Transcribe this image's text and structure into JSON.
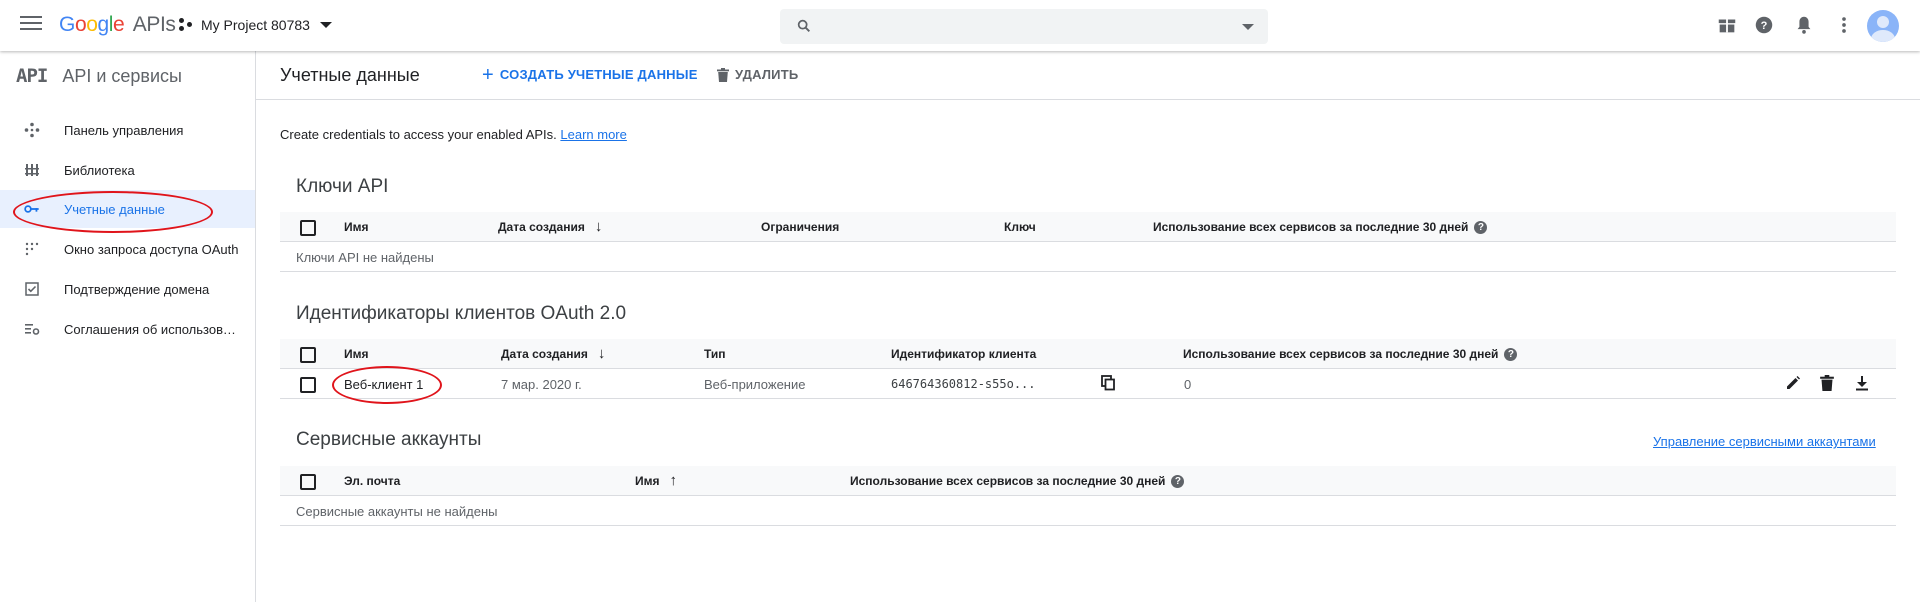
{
  "topbar": {
    "logo_google": "Google",
    "logo_apis": "APIs",
    "project_name": "My Project 80783",
    "search_placeholder": ""
  },
  "icons": {
    "menu": "menu-icon",
    "project": "project-dots-icon",
    "search": "search-icon",
    "gift": "gift-icon",
    "help": "help-icon",
    "notifications": "bell-icon",
    "more": "more-vert-icon",
    "avatar": "account-avatar"
  },
  "sidebar": {
    "api_logo": "API",
    "title": "API и сервисы",
    "items": [
      {
        "label": "Панель управления",
        "icon": "dashboard-icon",
        "active": false
      },
      {
        "label": "Библиотека",
        "icon": "library-icon",
        "active": false
      },
      {
        "label": "Учетные данные",
        "icon": "key-icon",
        "active": true
      },
      {
        "label": "Окно запроса доступа OAuth",
        "icon": "consent-screen-icon",
        "active": false
      },
      {
        "label": "Подтверждение домена",
        "icon": "checkbox-icon",
        "active": false
      },
      {
        "label": "Соглашения об использовании",
        "icon": "settings-list-icon",
        "active": false
      }
    ]
  },
  "page": {
    "title": "Учетные данные",
    "create_label": "СОЗДАТЬ УЧЕТНЫЕ ДАННЫЕ",
    "delete_label": "УДАЛИТЬ",
    "intro_text": "Create credentials to access your enabled APIs.",
    "learn_more": "Learn more"
  },
  "api_keys": {
    "title": "Ключи API",
    "columns": [
      "Имя",
      "Дата создания",
      "Ограничения",
      "Ключ",
      "Использование всех сервисов за последние 30 дней"
    ],
    "empty": "Ключи API не найдены"
  },
  "oauth": {
    "title": "Идентификаторы клиентов OAuth 2.0",
    "columns": [
      "Имя",
      "Дата создания",
      "Тип",
      "Идентификатор клиента",
      "Использование всех сервисов за последние 30 дней"
    ],
    "rows": [
      {
        "name": "Веб-клиент 1",
        "created": "7 мар. 2020 г.",
        "type": "Веб-приложение",
        "client_id": "646764360812-s55o...",
        "usage": "0"
      }
    ]
  },
  "service_accounts": {
    "title": "Сервисные аккаунты",
    "manage_link": "Управление сервисными аккаунтами",
    "columns": [
      "Эл. почта",
      "Имя",
      "Использование всех сервисов за последние 30 дней"
    ],
    "empty": "Сервисные аккаунты не найдены"
  },
  "colors": {
    "accent": "#1a73e8",
    "active_bg": "#e8f0fe",
    "annotation": "#e0141b"
  }
}
